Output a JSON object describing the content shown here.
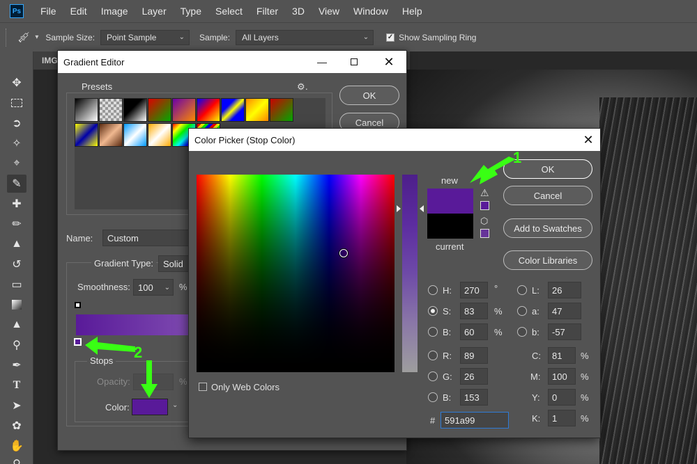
{
  "menubar": {
    "logo": "Ps",
    "items": [
      "File",
      "Edit",
      "Image",
      "Layer",
      "Type",
      "Select",
      "Filter",
      "3D",
      "View",
      "Window",
      "Help"
    ]
  },
  "options_bar": {
    "sample_size_label": "Sample Size:",
    "sample_size_value": "Point Sample",
    "sample_label": "Sample:",
    "sample_value": "All Layers",
    "show_ring_label": "Show Sampling Ring",
    "show_ring_checked": true
  },
  "document_tab": {
    "title": "IMG"
  },
  "gradient_editor": {
    "title": "Gradient Editor",
    "presets_label": "Presets",
    "ok_label": "OK",
    "cancel_label": "Cancel",
    "name_label": "Name:",
    "name_value": "Custom",
    "gradient_type_label": "Gradient Type:",
    "gradient_type_value": "Solid",
    "smoothness_label": "Smoothness:",
    "smoothness_value": "100",
    "smoothness_unit": "%",
    "stops_label": "Stops",
    "opacity_label": "Opacity:",
    "opacity_unit": "%",
    "color_label": "Color:",
    "stop_color": "#591a99"
  },
  "color_picker": {
    "title": "Color Picker (Stop Color)",
    "new_label": "new",
    "current_label": "current",
    "new_color": "#591a99",
    "current_color": "#000000",
    "ok_label": "OK",
    "cancel_label": "Cancel",
    "add_swatches_label": "Add to Swatches",
    "color_libraries_label": "Color Libraries",
    "only_web_colors_label": "Only Web Colors",
    "hsb": {
      "h_label": "H:",
      "h": "270",
      "h_unit": "°",
      "s_label": "S:",
      "s": "83",
      "s_unit": "%",
      "b_label": "B:",
      "b": "60",
      "b_unit": "%"
    },
    "rgb": {
      "r_label": "R:",
      "r": "89",
      "g_label": "G:",
      "g": "26",
      "b_label": "B:",
      "b": "153"
    },
    "lab": {
      "l_label": "L:",
      "l": "26",
      "a_label": "a:",
      "a": "47",
      "b_label": "b:",
      "b": "-57"
    },
    "cmyk": {
      "c_label": "C:",
      "c": "81",
      "m_label": "M:",
      "m": "100",
      "y_label": "Y:",
      "y": "0",
      "k_label": "K:",
      "k": "1",
      "unit": "%"
    },
    "hex_label": "#",
    "hex_value": "591a99"
  },
  "annotations": {
    "arrow1": "1",
    "arrow2": "2",
    "color": "#39ff14"
  }
}
